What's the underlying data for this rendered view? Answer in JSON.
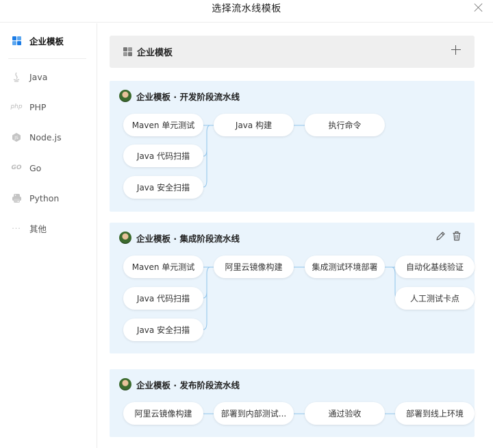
{
  "title": "选择流水线模板",
  "sidebar": {
    "items": [
      {
        "label": "企业模板",
        "icon": "grid-icon"
      },
      {
        "label": "Java",
        "icon": "java-icon"
      },
      {
        "label": "PHP",
        "icon": "php-icon"
      },
      {
        "label": "Node.js",
        "icon": "nodejs-icon"
      },
      {
        "label": "Go",
        "icon": "go-icon"
      },
      {
        "label": "Python",
        "icon": "python-icon"
      },
      {
        "label": "其他",
        "icon": "more-icon"
      }
    ]
  },
  "add_template": {
    "label": "企业模板",
    "icon": "grid-icon",
    "action_icon": "plus-icon"
  },
  "templates": [
    {
      "title": "企业模板 · 开发阶段流水线",
      "stages": [
        [
          "Maven 单元测试",
          "Java 代码扫描",
          "Java 安全扫描"
        ],
        [
          "Java 构建"
        ],
        [
          "执行命令"
        ]
      ]
    },
    {
      "title": "企业模板 · 集成阶段流水线",
      "actions": [
        "edit-icon",
        "delete-icon"
      ],
      "stages": [
        [
          "Maven 单元测试",
          "Java 代码扫描",
          "Java 安全扫描"
        ],
        [
          "阿里云镜像构建"
        ],
        [
          "集成测试环境部署"
        ],
        [
          "自动化基线验证",
          "人工测试卡点"
        ]
      ]
    },
    {
      "title": "企业模板 · 发布阶段流水线",
      "stages": [
        [
          "阿里云镜像构建"
        ],
        [
          "部署到内部测试..."
        ],
        [
          "通过验收"
        ],
        [
          "部署到线上环境"
        ]
      ]
    }
  ],
  "colors": {
    "accent": "#1b7ce6",
    "card_bg": "#eaf4fc",
    "connector": "#8fc3ea"
  }
}
